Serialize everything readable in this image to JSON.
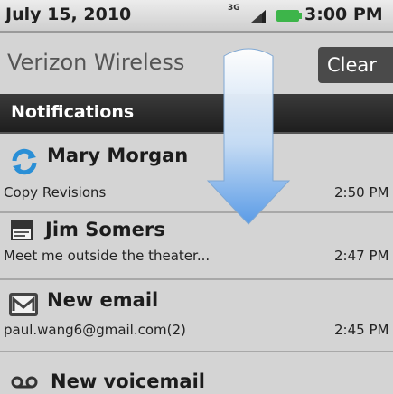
{
  "status_bar": {
    "date": "July 15, 2010",
    "network": "3G",
    "time": "3:00 PM",
    "battery_color": "#3db54a"
  },
  "header": {
    "carrier": "Verizon Wireless",
    "clear_label": "Clear"
  },
  "section": {
    "title": "Notifications"
  },
  "notifications": [
    {
      "title": "Mary Morgan",
      "subtitle": "Copy Revisions",
      "time": "2:50 PM",
      "icon": "sync-icon"
    },
    {
      "title": "Jim Somers",
      "subtitle": "Meet me outside the theater...",
      "time": "2:47 PM",
      "icon": "message-icon"
    },
    {
      "title": "New email",
      "subtitle": "paul.wang6@gmail.com(2)",
      "time": "2:45 PM",
      "icon": "gmail-icon"
    },
    {
      "title": "New voicemail",
      "subtitle": "",
      "time": "",
      "icon": "voicemail-icon"
    }
  ],
  "accent": "#5a9be6"
}
